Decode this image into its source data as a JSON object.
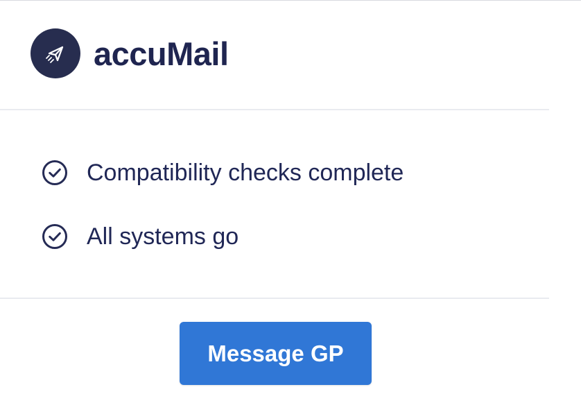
{
  "app": {
    "name": "accuMail",
    "logo_icon": "paper-plane-icon"
  },
  "checks": [
    {
      "icon": "check-circle-icon",
      "label": "Compatibility checks complete"
    },
    {
      "icon": "check-circle-icon",
      "label": "All systems go"
    }
  ],
  "actions": {
    "message_button_label": "Message GP"
  },
  "colors": {
    "logo_background": "#272d4f",
    "text": "#1f2550",
    "button": "#3077d6",
    "divider": "#e9ebf0"
  }
}
